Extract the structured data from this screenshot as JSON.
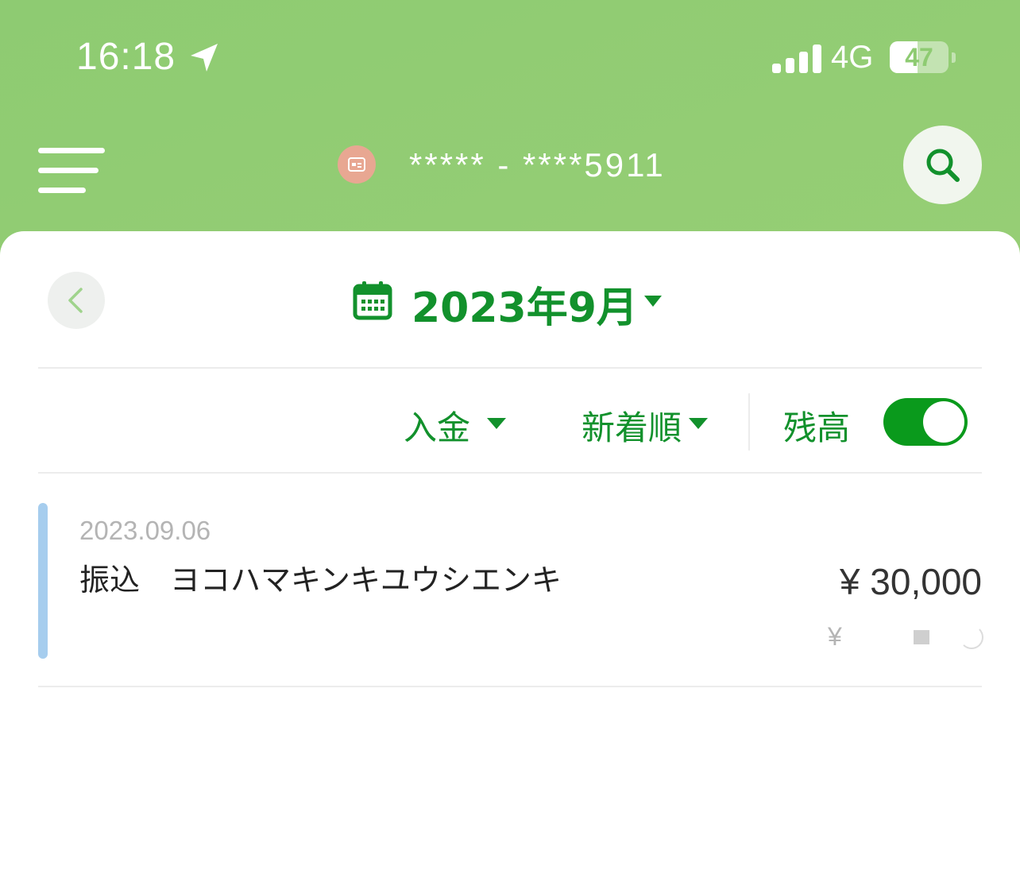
{
  "status_bar": {
    "time": "16:18",
    "network": "4G",
    "battery": "47",
    "battery_level": 0.47
  },
  "header": {
    "account_number": "***** - ****5911",
    "icons": [
      "menu-icon",
      "account-card-icon",
      "search-icon"
    ]
  },
  "month_nav": {
    "month_label": "2023年9月",
    "icons": [
      "chevron-left-icon",
      "calendar-icon",
      "caret-down-icon"
    ]
  },
  "filters": {
    "type_label": "入金",
    "sort_label": "新着順",
    "balance_label": "残高",
    "balance_toggle_on": true
  },
  "transactions": [
    {
      "date": "2023.09.06",
      "description": "振込　ヨコハマキンキユウシエンキ",
      "amount": "¥ 30,000",
      "balance_prefix": "¥"
    }
  ],
  "colors": {
    "accent_green": "#12912c",
    "header_green": "#8ecb72",
    "toggle_green": "#0a9a1c",
    "row_bar_blue": "#a6cdee"
  }
}
